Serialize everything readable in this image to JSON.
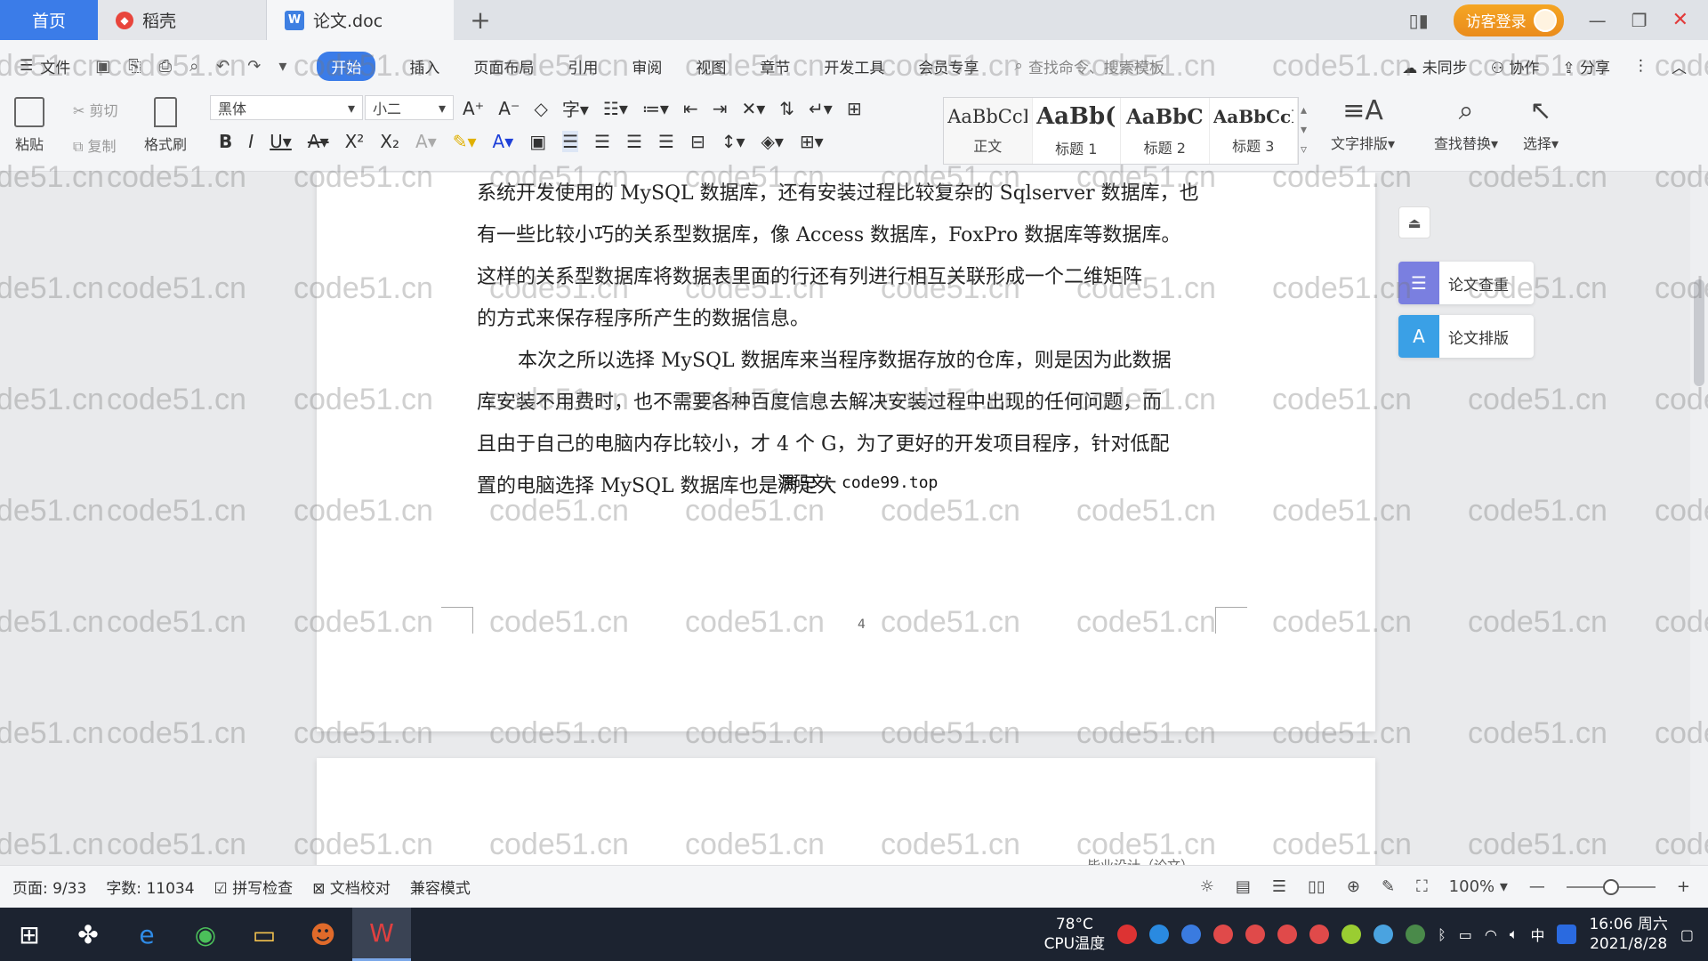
{
  "titlebar": {
    "tabs": [
      {
        "label": "首页"
      },
      {
        "label": "稻壳"
      },
      {
        "label": "论文.doc"
      }
    ],
    "visitor_login": "访客登录"
  },
  "menubar": {
    "file": "文件",
    "items": [
      "开始",
      "插入",
      "页面布局",
      "引用",
      "审阅",
      "视图",
      "章节",
      "开发工具",
      "会员专享"
    ],
    "search_placeholder": "查找命令、搜索模板",
    "unsynced": "未同步",
    "collaborate": "协作",
    "share": "分享"
  },
  "ribbon": {
    "paste": "粘贴",
    "cut": "剪切",
    "copy": "复制",
    "format_painter": "格式刷",
    "font_name": "黑体",
    "font_size": "小二",
    "styles": [
      {
        "preview": "AaBbCcI",
        "label": "正文"
      },
      {
        "preview": "AaBb(",
        "label": "标题 1"
      },
      {
        "preview": "AaBbC",
        "label": "标题 2"
      },
      {
        "preview": "AaBbCcI",
        "label": "标题 3"
      }
    ],
    "text_layout": "文字排版",
    "find_replace": "查找替换",
    "select": "选择"
  },
  "document": {
    "para1": [
      "系统开发使用的 MySQL 数据库，还有安装过程比较复杂的 Sqlserver 数据库，也",
      "有一些比较小巧的关系型数据库，像 Access 数据库，FoxPro 数据库等数据库。",
      "这样的关系型数据库将数据表里面的行还有列进行相互关联形成一个二维矩阵",
      "的方式来保存程序所产生的数据信息。"
    ],
    "para2": [
      "本次之所以选择 MySQL 数据库来当程序数据存放的仓库，则是因为此数据",
      "库安装不用费时，也不需要各种百度信息去解决安装过程中出现的任何问题，而",
      "且由于自己的电脑内存比较小，才 4 个 G，为了更好的开发项目程序，针对低配",
      "置的电脑选择 MySQL 数据库也是满足大"
    ],
    "overlay_text": "源码文：code99.top",
    "page_number": "4",
    "next_page_header": "毕业设计（论文）"
  },
  "side_panel": {
    "check": "论文查重",
    "layout": "论文排版"
  },
  "watermark": "code51.cn",
  "statusbar": {
    "page": "页面: 9/33",
    "words": "字数: 11034",
    "spell_check": "拼写检查",
    "doc_proof": "文档校对",
    "compat_mode": "兼容模式",
    "zoom": "100%",
    "zoom_level": 100
  },
  "taskbar": {
    "cpu_temp": "78°C",
    "cpu_label": "CPU温度",
    "ime": "中",
    "time": "16:06 周六",
    "date": "2021/8/28"
  },
  "colors": {
    "accent": "#3b7ce8",
    "visitor": "#f0981f",
    "taskbar": "#1c2330"
  }
}
